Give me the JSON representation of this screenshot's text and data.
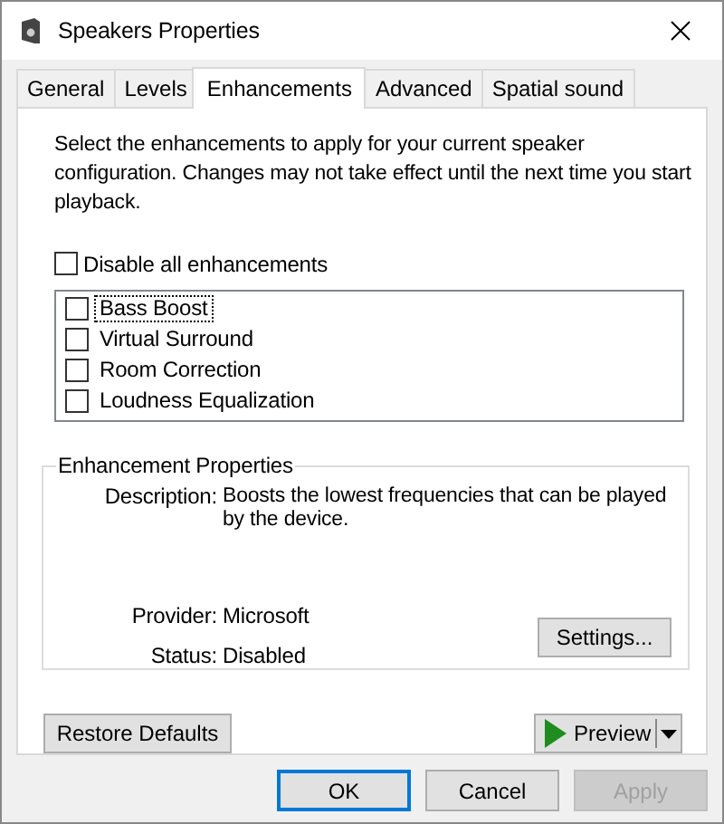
{
  "window": {
    "title": "Speakers Properties"
  },
  "tabs": [
    {
      "label": "General",
      "selected": false
    },
    {
      "label": "Levels",
      "selected": false
    },
    {
      "label": "Enhancements",
      "selected": true
    },
    {
      "label": "Advanced",
      "selected": false
    },
    {
      "label": "Spatial sound",
      "selected": false
    }
  ],
  "intro": "Select the enhancements to apply for your current speaker configuration. Changes may not take effect until the next time you start playback.",
  "disable_all": {
    "label": "Disable all enhancements",
    "checked": false
  },
  "enhancements": [
    {
      "label": "Bass Boost",
      "checked": false,
      "selected": true
    },
    {
      "label": "Virtual Surround",
      "checked": false,
      "selected": false
    },
    {
      "label": "Room Correction",
      "checked": false,
      "selected": false
    },
    {
      "label": "Loudness Equalization",
      "checked": false,
      "selected": false
    }
  ],
  "properties": {
    "title": "Enhancement Properties",
    "fields": [
      {
        "label": "Description:",
        "value": "Boosts the lowest frequencies that can be played by the device."
      },
      {
        "label": "Provider:",
        "value": "Microsoft"
      },
      {
        "label": "Status:",
        "value": "Disabled"
      }
    ],
    "settings_button": "Settings..."
  },
  "restore_button": "Restore Defaults",
  "preview_button": "Preview",
  "buttons": [
    {
      "label": "OK",
      "default": true,
      "disabled": false
    },
    {
      "label": "Cancel",
      "default": false,
      "disabled": false
    },
    {
      "label": "Apply",
      "default": false,
      "disabled": true
    }
  ]
}
